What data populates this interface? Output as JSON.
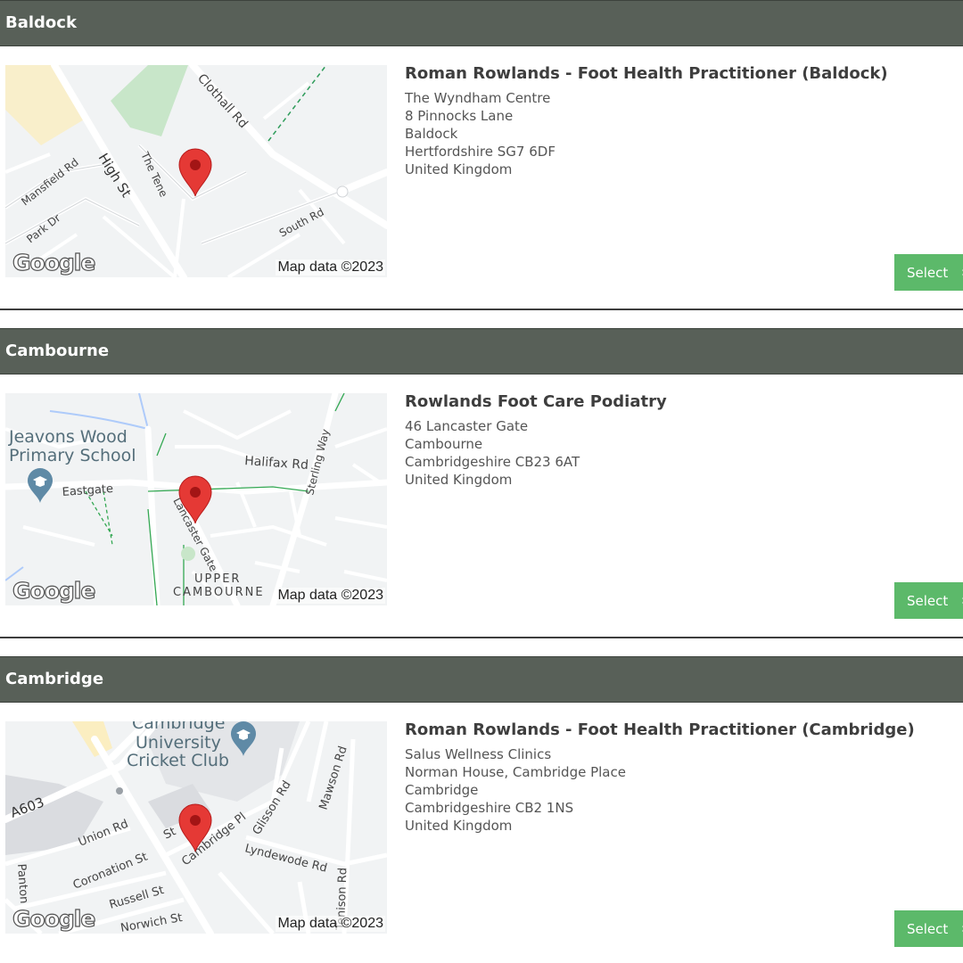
{
  "locations": [
    {
      "region": "Baldock",
      "clinic_name": "Roman Rowlands - Foot Health Practitioner (Baldock)",
      "address": [
        "The Wyndham Centre",
        "8 Pinnocks Lane",
        "Baldock",
        "Hertfordshire SG7 6DF",
        "United Kingdom"
      ],
      "select_label": "Select",
      "map": {
        "logo": "Google",
        "credit": "Map data ©2023",
        "labels": [
          "Clothall Rd",
          "High St",
          "The Tene",
          "Mansfield Rd",
          "Park Dr",
          "South Rd"
        ]
      }
    },
    {
      "region": "Cambourne",
      "clinic_name": "Rowlands Foot Care Podiatry",
      "address": [
        "46 Lancaster Gate",
        "Cambourne",
        "Cambridgeshire CB23 6AT",
        "United Kingdom"
      ],
      "select_label": "Select",
      "map": {
        "logo": "Google",
        "credit": "Map data ©2023",
        "labels": [
          "Jeavons Wood",
          "Primary School",
          "Eastgate",
          "Halifax Rd",
          "Sterling Way",
          "Lancaster Gate",
          "UPPER",
          "CAMBOURNE"
        ]
      }
    },
    {
      "region": "Cambridge",
      "clinic_name": "Roman Rowlands - Foot Health Practitioner (Cambridge)",
      "address": [
        "Salus Wellness Clinics",
        "Norman House, Cambridge Place",
        "Cambridge",
        "Cambridgeshire CB2 1NS",
        "United Kingdom"
      ],
      "select_label": "Select",
      "map": {
        "logo": "Google",
        "credit": "Map data ©2023",
        "labels": [
          "Cambridge",
          "University",
          "Cricket Club",
          "A603",
          "Union Rd",
          "Coronation St",
          "Russell St",
          "Norwich St",
          "Panton",
          "Cambridge Pl",
          "Glisson Rd",
          "Mawson Rd",
          "Lyndewode Rd",
          "Tenison Rd",
          "St"
        ]
      }
    }
  ],
  "icons": {
    "pin": "map-pin-icon",
    "school": "school-icon",
    "chevron": "chevron-right-icon"
  },
  "colors": {
    "header_bg": "#586058",
    "select_bg": "#5cb96a",
    "pin": "#e53935"
  }
}
